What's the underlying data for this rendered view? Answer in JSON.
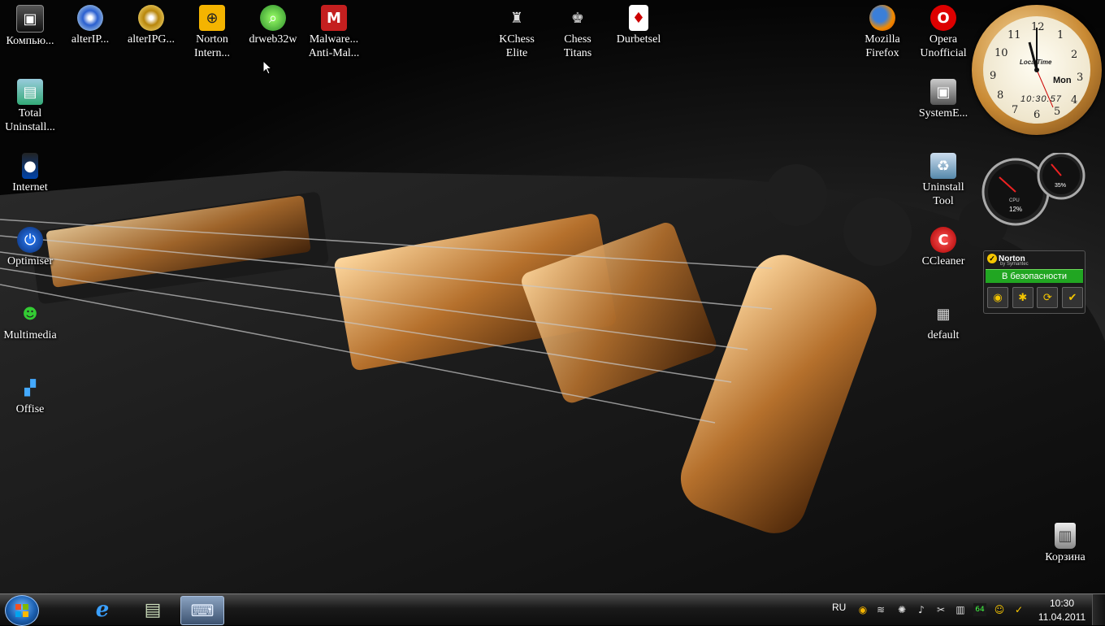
{
  "desktop_icons": {
    "computer": {
      "label": "Компью...",
      "icon": "computer-icon"
    },
    "alteripd": {
      "label": "alterIP...",
      "icon": "dvd-icon"
    },
    "alteripg": {
      "label": "alterIPG...",
      "icon": "dvd-gold-icon"
    },
    "norton": {
      "label": "Norton\nIntern...",
      "icon": "norton-icon"
    },
    "drweb": {
      "label": "drweb32w",
      "icon": "drweb-icon"
    },
    "malwarebytes": {
      "label": "Malware...\nAnti-Mal...",
      "icon": "malwarebytes-icon"
    },
    "kchess": {
      "label": "KChess\nElite",
      "icon": "chess-board-icon"
    },
    "chesstitans": {
      "label": "Chess\nTitans",
      "icon": "chess-king-icon"
    },
    "durbetsel": {
      "label": "Durbetsel",
      "icon": "playing-card-icon"
    },
    "firefox": {
      "label": "Mozilla\nFirefox",
      "icon": "firefox-icon"
    },
    "opera": {
      "label": "Opera\nUnofficial",
      "icon": "opera-icon"
    },
    "totaluninstall": {
      "label": "Total\nUninstall...",
      "icon": "uninstaller-icon"
    },
    "systemexplorer": {
      "label": "SystemE...",
      "icon": "system-explorer-icon"
    },
    "internet": {
      "label": "Internet",
      "icon": "internet-icon"
    },
    "uninstalltool": {
      "label": "Uninstall\nTool",
      "icon": "recycle-bin-blue-icon"
    },
    "optimiser": {
      "label": "Optimiser",
      "icon": "power-icon"
    },
    "ccleaner": {
      "label": "CCleaner",
      "icon": "ccleaner-icon"
    },
    "multimedia": {
      "label": "Multimedia",
      "icon": "multimedia-icon"
    },
    "default": {
      "label": "default",
      "icon": "chip-icon"
    },
    "offise": {
      "label": "Offise",
      "icon": "office-icon"
    },
    "recyclebin": {
      "label": "Корзина",
      "icon": "recycle-bin-icon"
    }
  },
  "clock_gadget": {
    "brand": "LocalTime",
    "day": "Mon",
    "digital_time": "10:30:57",
    "numbers": [
      "12",
      "1",
      "2",
      "3",
      "4",
      "5",
      "6",
      "7",
      "8",
      "9",
      "10",
      "11"
    ]
  },
  "cpu_gadget": {
    "cpu_percent": "12%",
    "memory_percent": "35%",
    "cpu_label": "CPU"
  },
  "norton_gadget": {
    "brand": "Norton",
    "subbrand": "by Symantec",
    "status": "В безопасности",
    "status_color": "#21a622"
  },
  "taskbar": {
    "apps": [
      {
        "name": "Internet Explorer",
        "icon": "internet-explorer-icon"
      },
      {
        "name": "Library",
        "icon": "library-icon"
      },
      {
        "name": "Remote keyboard",
        "icon": "keyboard-monitor-icon"
      }
    ],
    "language": "RU",
    "time": "10:30",
    "date": "11.04.2011"
  }
}
